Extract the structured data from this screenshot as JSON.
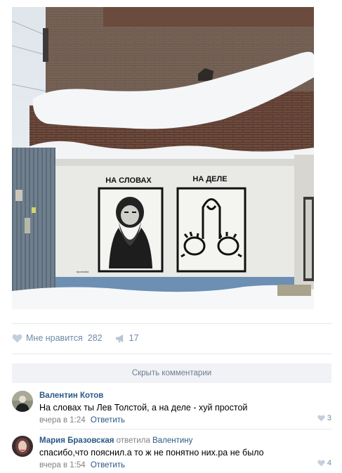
{
  "post": {
    "image_alt": "Граффити на стене",
    "mural": {
      "left_caption": "НА СЛОВАХ",
      "right_caption": "НА ДЕЛЕ",
      "signature": "#pomoika"
    }
  },
  "actions": {
    "like_label": "Мне нравится",
    "like_count": "282",
    "share_count": "17",
    "like_icon": "heart-icon",
    "share_icon": "megaphone-icon",
    "accent_color": "#6f8aa8"
  },
  "hide_comments_label": "Скрыть комментарии",
  "comments": [
    {
      "author": "Валентин Котов",
      "text": "На словах ты Лев Толстой, а на деле - хуй простой",
      "time": "вчера в 1:24",
      "reply_label": "Ответить",
      "likes": "3"
    },
    {
      "author": "Мария Бразовская",
      "replied_word": "ответила",
      "reply_to": "Валентину",
      "text": "спасибо,что пояснил.а то ж не понятно них.ра не было",
      "time": "вчера в 1:54",
      "reply_label": "Ответить",
      "likes": "4"
    }
  ],
  "colors": {
    "link": "#2a5885",
    "muted": "#828282",
    "button_bg": "#f0f2f5"
  }
}
